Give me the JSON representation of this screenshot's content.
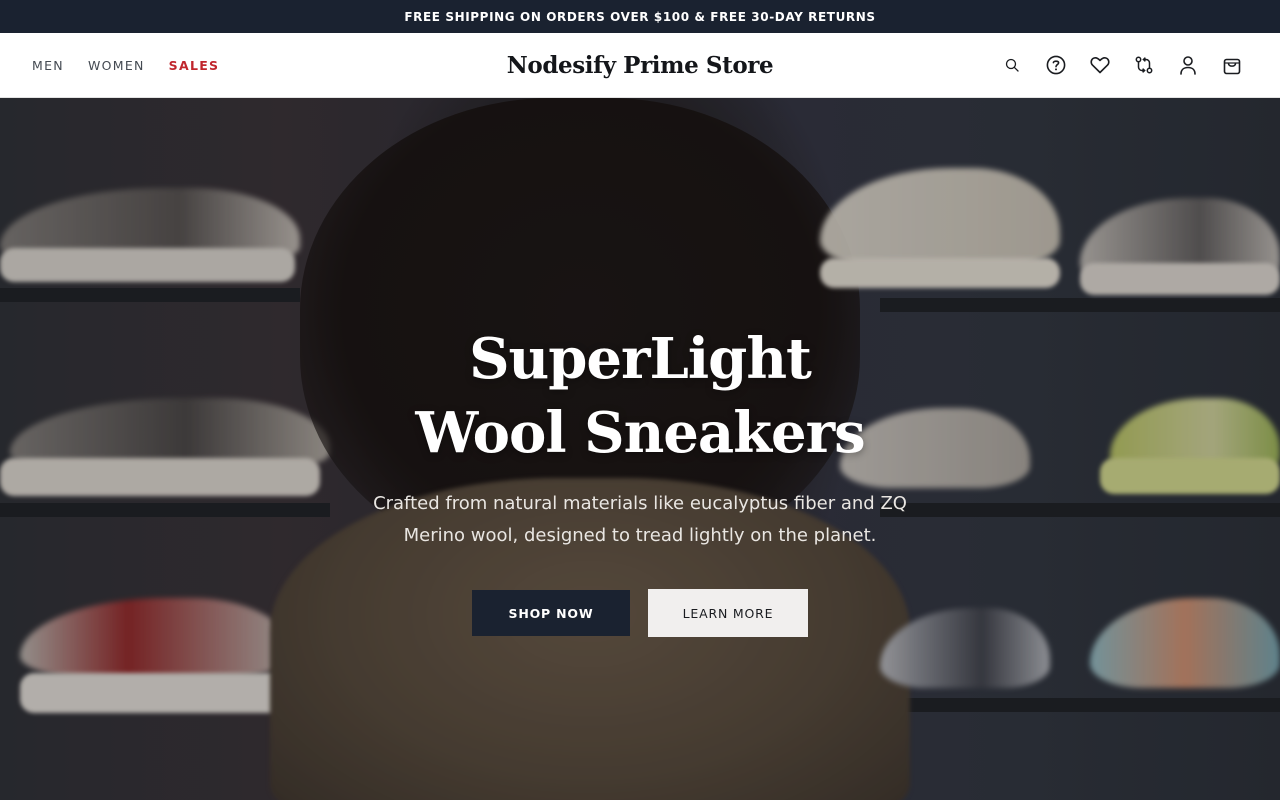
{
  "promo": {
    "text": "FREE SHIPPING ON ORDERS OVER $100 & FREE 30-DAY RETURNS"
  },
  "header": {
    "brand": "Nodesify Prime Store",
    "nav": [
      {
        "label": "MEN"
      },
      {
        "label": "WOMEN"
      },
      {
        "label": "SALES"
      }
    ],
    "icons": [
      "search-icon",
      "help-icon",
      "wishlist-heart-icon",
      "compare-icon",
      "account-icon",
      "cart-bag-icon"
    ]
  },
  "hero": {
    "title_line1": "SuperLight",
    "title_line2": "Wool Sneakers",
    "subtitle": "Crafted from natural materials like eucalyptus fiber and ZQ Merino wool, designed to tread lightly on the planet.",
    "primary_button": "SHOP NOW",
    "secondary_button": "LEARN MORE"
  },
  "colors": {
    "promo_bg": "#1a2230",
    "sale_accent": "#c0262d",
    "primary_button_bg": "#1a2230",
    "secondary_button_bg": "#f1efee"
  }
}
